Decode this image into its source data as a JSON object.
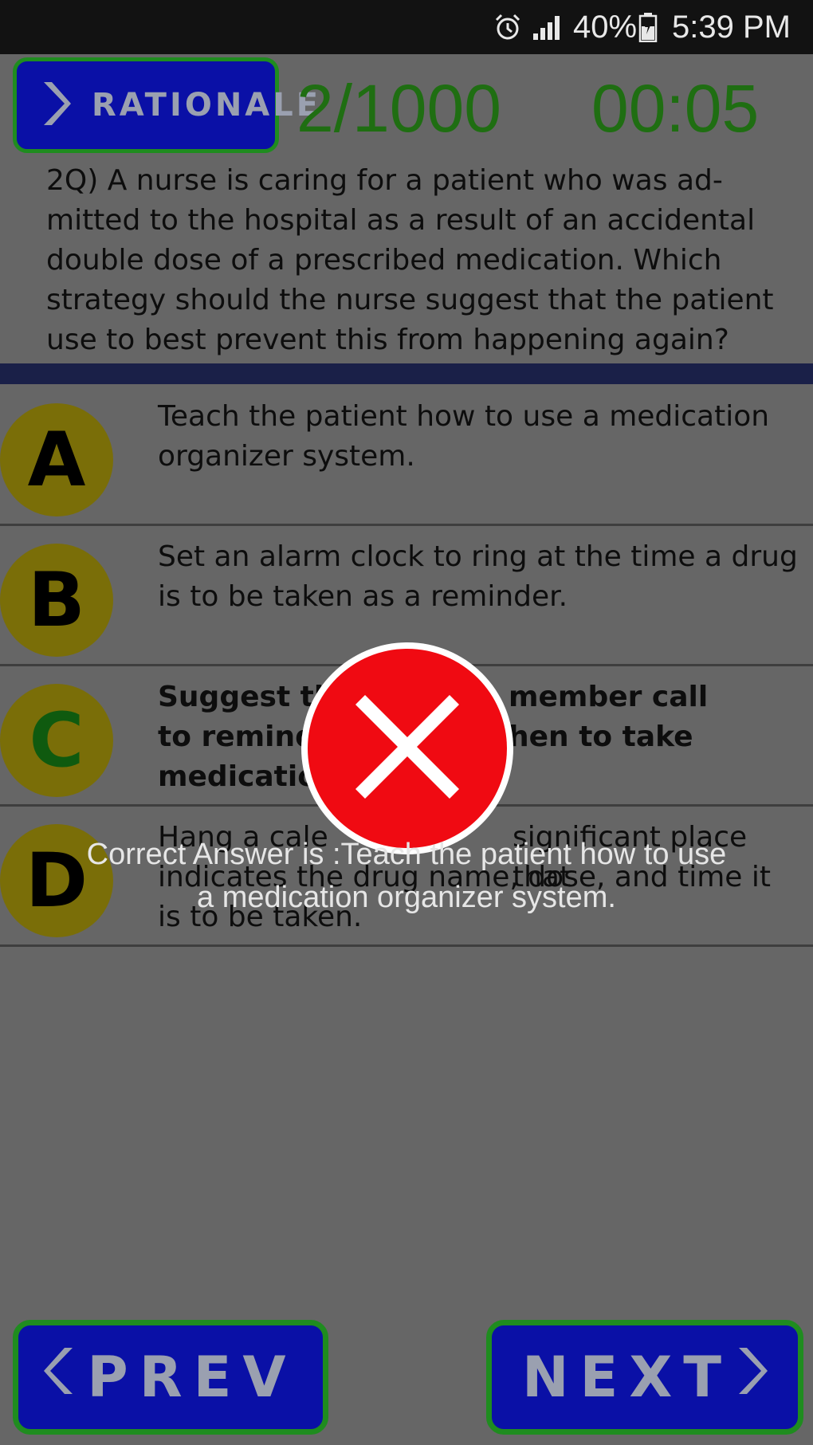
{
  "status_bar": {
    "battery": "40%",
    "time": "5:39 PM",
    "icons": [
      "alarm-icon",
      "signal-icon",
      "battery-charging-icon"
    ]
  },
  "header": {
    "rationale_label": "RATIONALE",
    "counter": "2/1000",
    "timer": "00:05"
  },
  "question": {
    "lines": [
      "2Q) A nurse is caring for a patient who was ad-",
      "mitted to the hospital as a result of an accidental",
      "double dose of a prescribed medication. Which",
      "strategy should the nurse suggest that the patient",
      "use to best prevent this from happening again?"
    ]
  },
  "options": [
    {
      "letter": "A",
      "lines": [
        "Teach the patient how to use a medication",
        "organizer system."
      ]
    },
    {
      "letter": "B",
      "lines": [
        "Set an alarm clock to ring at the time a drug",
        "is to be taken as a reminder."
      ]
    },
    {
      "letter": "C",
      "lines": [
        "Suggest th",
        "to remind",
        "medicatio"
      ],
      "lines_right": [
        "member call",
        "hen to take"
      ]
    },
    {
      "letter": "D",
      "lines": [
        "Hang a cale",
        "indicates the drug name, dose, and time it",
        "is to be taken."
      ],
      "line1_right": "significant place that"
    }
  ],
  "result": {
    "icon": "wrong-x-icon",
    "message_line1": "Correct Answer is :Teach the patient how to use",
    "message_line2": "a medication organizer system."
  },
  "navigation": {
    "prev_label": "PREV",
    "next_label": "NEXT"
  },
  "colors": {
    "button_fill": "#0a10a6",
    "button_border": "#1f8c1f",
    "accent_green": "#1f6e12",
    "wrong_red": "#f00a12"
  }
}
